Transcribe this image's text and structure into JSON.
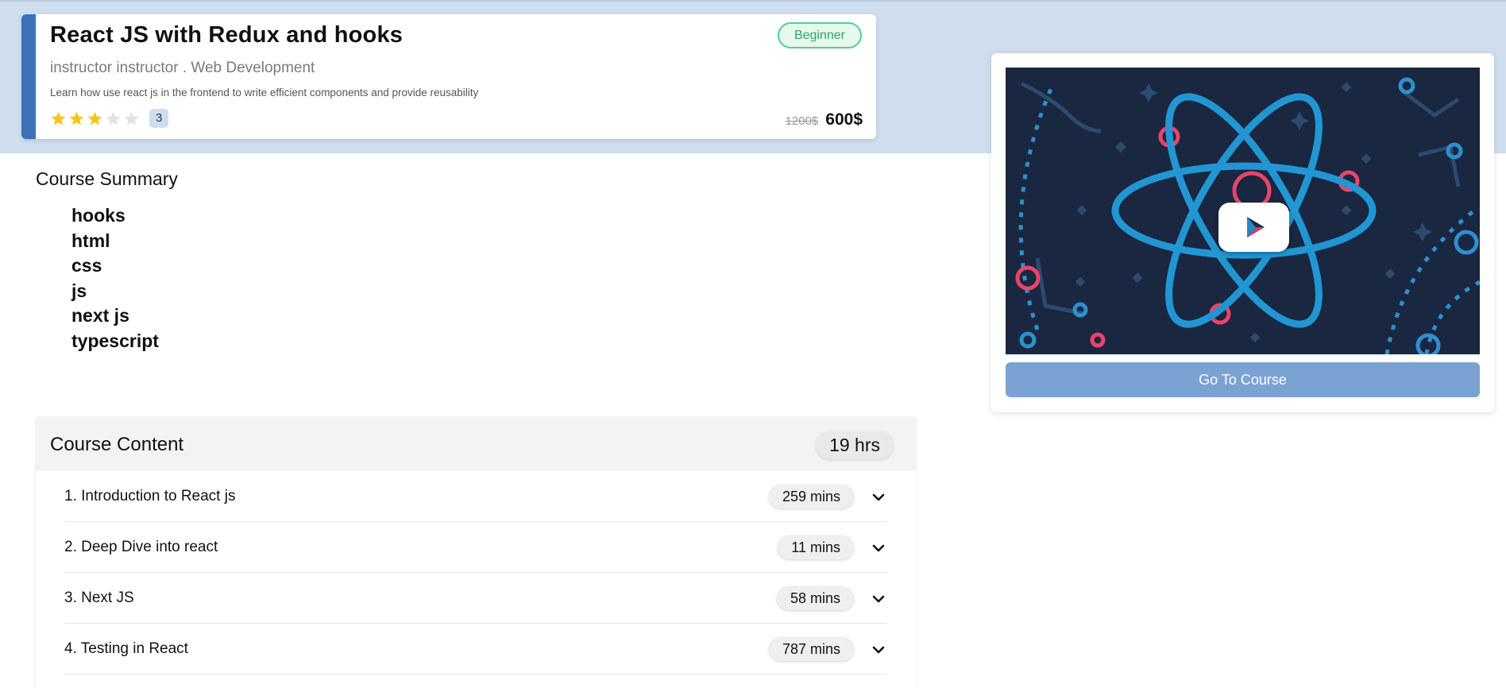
{
  "course": {
    "title": "React JS with Redux and hooks",
    "level": "Beginner",
    "meta": "instructor instructor . Web Development",
    "description": "Learn how use react js in the frontend to write efficient components and provide reusability",
    "rating": 3,
    "rating_max": 5,
    "rating_count": "3",
    "old_price": "1200$",
    "price": "600$"
  },
  "colors": {
    "band": "#cfdeee",
    "accent": "#3b72b8",
    "star_filled": "#f5c518",
    "star_empty": "#e2e2e2",
    "badge_border": "#4fd18d",
    "button": "#7aa3d4"
  },
  "summary": {
    "title": "Course Summary",
    "items": [
      "hooks",
      "html",
      "css",
      "js",
      "next js",
      "typescript"
    ]
  },
  "content": {
    "title": "Course Content",
    "total": "19 hrs",
    "sections": [
      {
        "title": "1. Introduction to React js",
        "duration": "259 mins"
      },
      {
        "title": "2. Deep Dive into react",
        "duration": "11 mins"
      },
      {
        "title": "3. Next JS",
        "duration": "58 mins"
      },
      {
        "title": "4. Testing in React",
        "duration": "787 mins"
      }
    ]
  },
  "preview": {
    "play_icon": "play-icon",
    "button_label": "Go To Course"
  }
}
